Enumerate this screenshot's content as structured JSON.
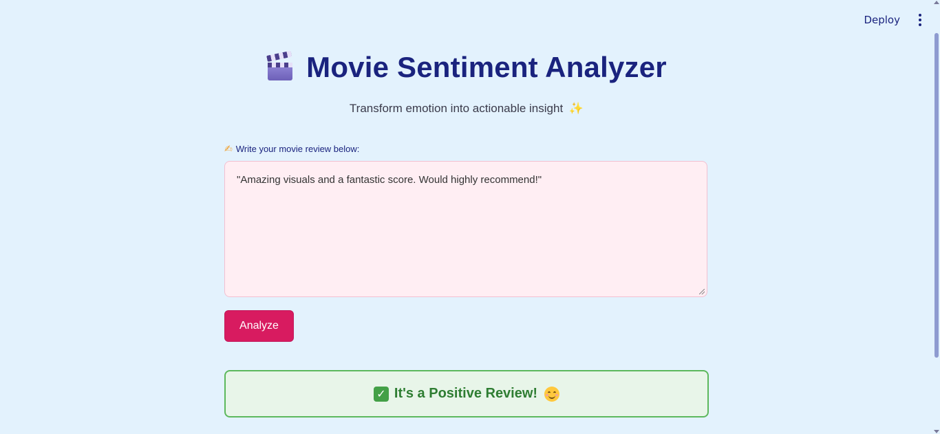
{
  "toolbar": {
    "deploy_label": "Deploy",
    "menu_icon": "kebab-menu-icon"
  },
  "header": {
    "icon": "clapperboard-icon",
    "title": "Movie Sentiment Analyzer",
    "subtitle": "Transform emotion into actionable insight",
    "subtitle_icon": "sparkles-icon",
    "subtitle_emoji": "✨"
  },
  "form": {
    "label_icon": "writing-hand-icon",
    "label_emoji": "✍",
    "label": "Write your movie review below:",
    "review_value": "\"Amazing visuals and a fantastic score. Would highly recommend!\"",
    "analyze_label": "Analyze"
  },
  "result": {
    "icon": "check-mark-icon",
    "text": "It's a Positive Review!",
    "trailing_icon": "smiling-face-icon"
  },
  "colors": {
    "background": "#e3f2fd",
    "title": "#1a237e",
    "button": "#d81b60",
    "textarea_bg": "#ffeef3",
    "success_border": "#5cb85c",
    "success_bg": "#e8f5e9",
    "success_text": "#2e7d32"
  }
}
